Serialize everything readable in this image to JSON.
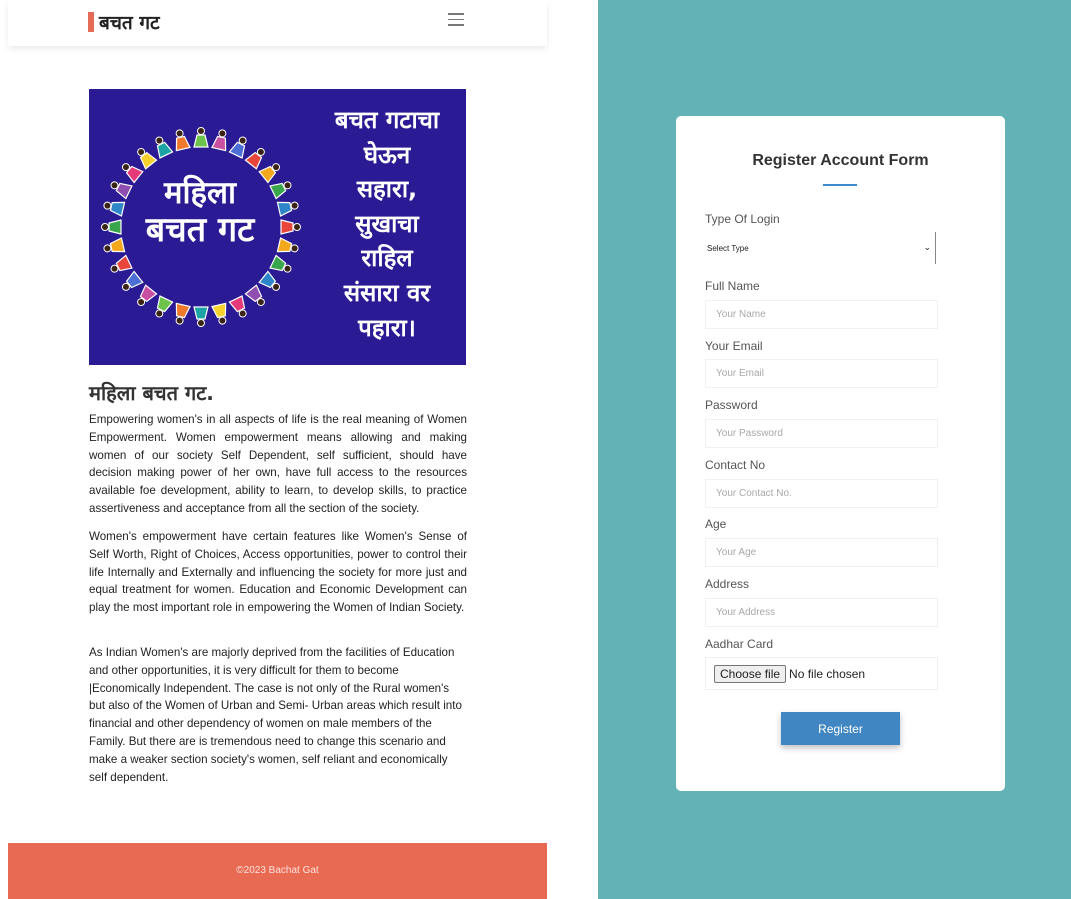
{
  "colors": {
    "brand_accent": "#e46b55",
    "banner_bg": "#2a1a93",
    "footer_bg": "#e86a53",
    "right_bg": "#62b2b6",
    "button_bg": "#3f86c2"
  },
  "header": {
    "brand": "बचत गट",
    "menu_icon": "hamburger-icon"
  },
  "banner": {
    "ring_line1": "महिला",
    "ring_line2": "बचत गट",
    "slogan": [
      "बचत गटाचा",
      "घेऊन",
      "सहारा,",
      "सुखाचा",
      "राहिल",
      "संसारा वर",
      "पहारा।"
    ]
  },
  "article": {
    "title": "महिला बचत गट.",
    "paragraphs": [
      "Empowering women's in all aspects of life is the real meaning of Women Empowerment. Women empowerment means allowing and making women of our society Self Dependent, self sufficient, should have decision making power of her own, have full access to the resources available foe development, ability to learn, to develop skills, to practice assertiveness and acceptance from all the section of the society.",
      "Women's empowerment have certain features like Women's Sense of Self Worth, Right of Choices, Access opportunities, power to control their life Internally and Externally and influencing the society for more just and equal treatment for women. Education and Economic Development can play the most important role in empowering the Women of Indian Society.",
      "As Indian Women's are majorly deprived from the facilities of Education and other opportunities, it is very difficult for them to become |Economically Independent. The case is not only of the Rural women's but also of the Women of Urban and Semi- Urban areas which result into financial and other dependency of women on male members of the Family. But there are is tremendous need to change this scenario and make a weaker section society's women, self reliant and economically self dependent."
    ]
  },
  "footer": {
    "text": "©2023 Bachat Gat"
  },
  "form": {
    "title": "Register Account Form",
    "type_label": "Type Of Login",
    "type_selected": "Select Type",
    "name_label": "Full Name",
    "name_placeholder": "Your Name",
    "email_label": "Your Email",
    "email_placeholder": "Your Email",
    "password_label": "Password",
    "password_placeholder": "Your Password",
    "contact_label": "Contact No",
    "contact_placeholder": "Your Contact No.",
    "age_label": "Age",
    "age_placeholder": "Your Age",
    "address_label": "Address",
    "address_placeholder": "Your Address",
    "aadhar_label": "Aadhar Card",
    "file_button": "Choose file",
    "file_status": "No file chosen",
    "submit": "Register"
  }
}
